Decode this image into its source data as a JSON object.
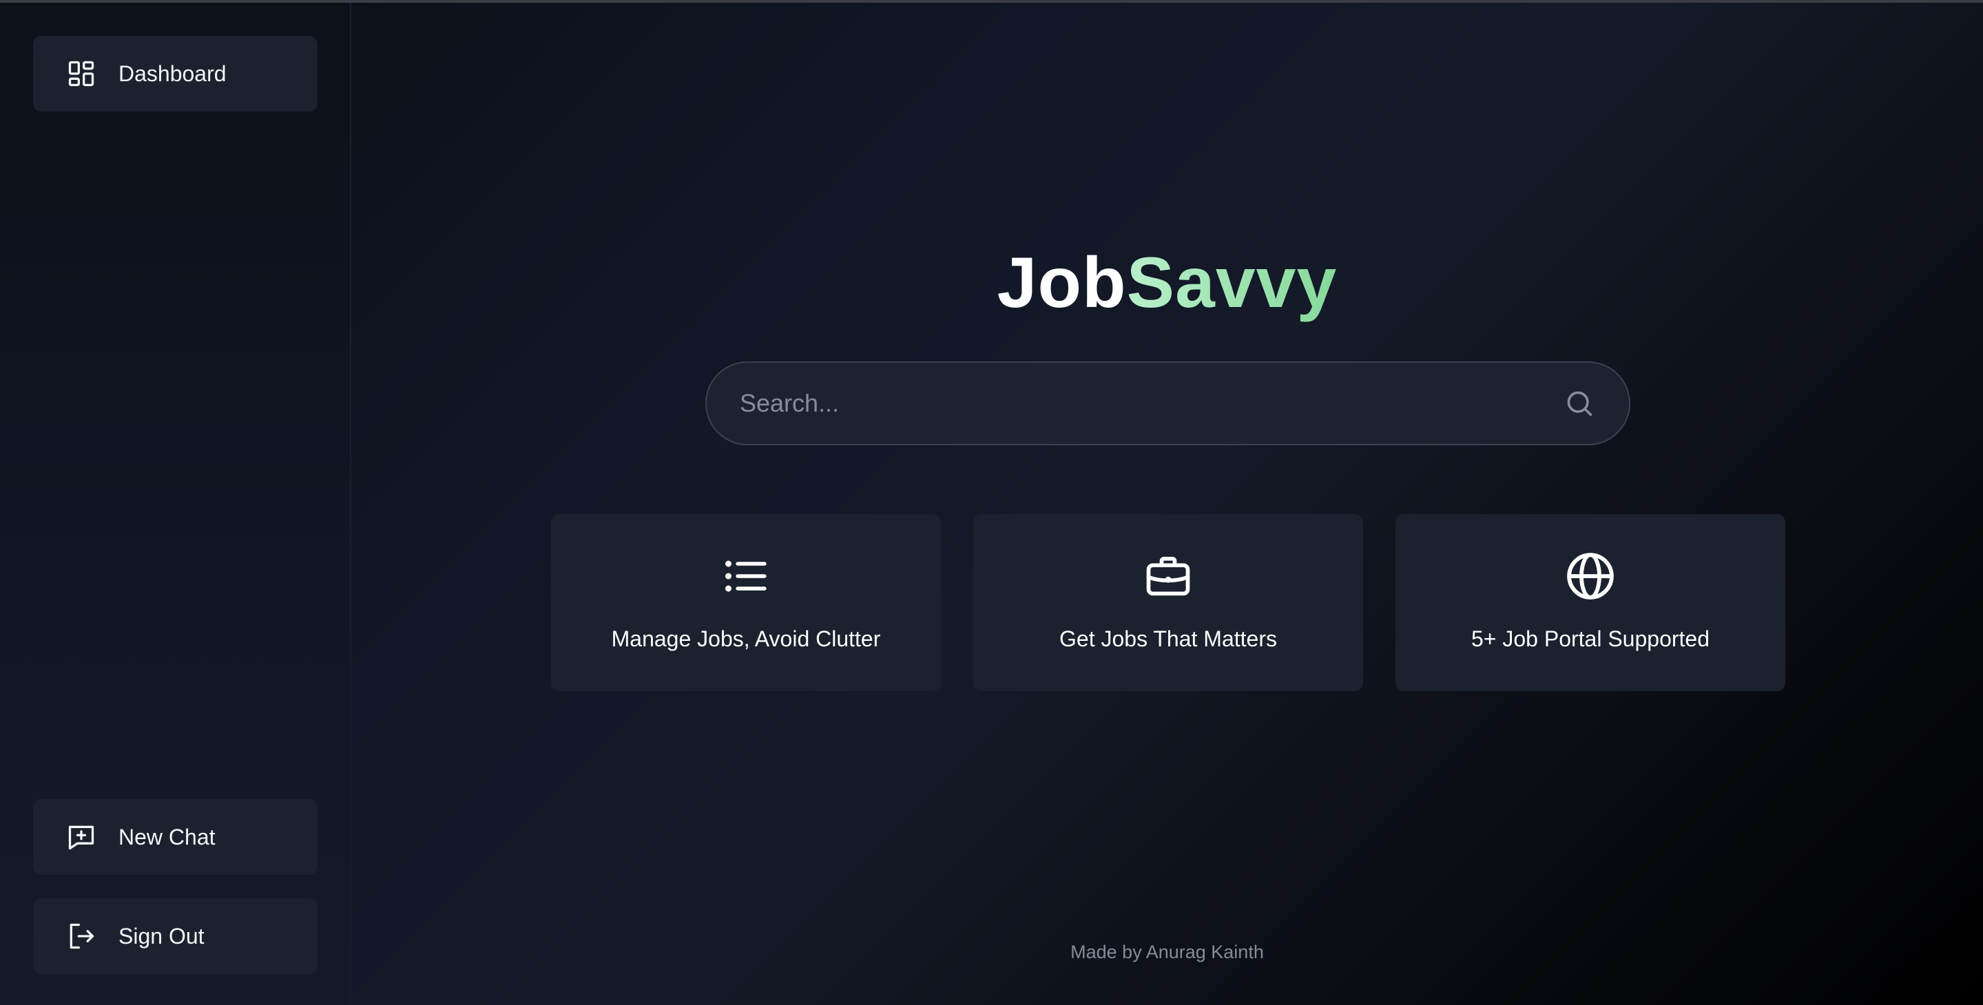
{
  "sidebar": {
    "dashboard": {
      "label": "Dashboard",
      "icon": "dashboard-grid-icon"
    },
    "new_chat": {
      "label": "New Chat",
      "icon": "message-plus-icon"
    },
    "sign_out": {
      "label": "Sign Out",
      "icon": "sign-out-icon"
    }
  },
  "main": {
    "brand": {
      "part1": "Job",
      "part2": "Savvy"
    },
    "search": {
      "placeholder": "Search...",
      "value": "",
      "icon": "search-icon"
    },
    "features": [
      {
        "label": "Manage Jobs, Avoid Clutter",
        "icon": "list-icon"
      },
      {
        "label": "Get Jobs That Matters",
        "icon": "briefcase-icon"
      },
      {
        "label": "5+ Job Portal Supported",
        "icon": "globe-icon"
      }
    ],
    "footer": "Made by Anurag Kainth"
  },
  "colors": {
    "background": "#0b0f18",
    "panel": "#1b212e",
    "accent_green": "#86d99a",
    "muted_text": "#868c98"
  }
}
